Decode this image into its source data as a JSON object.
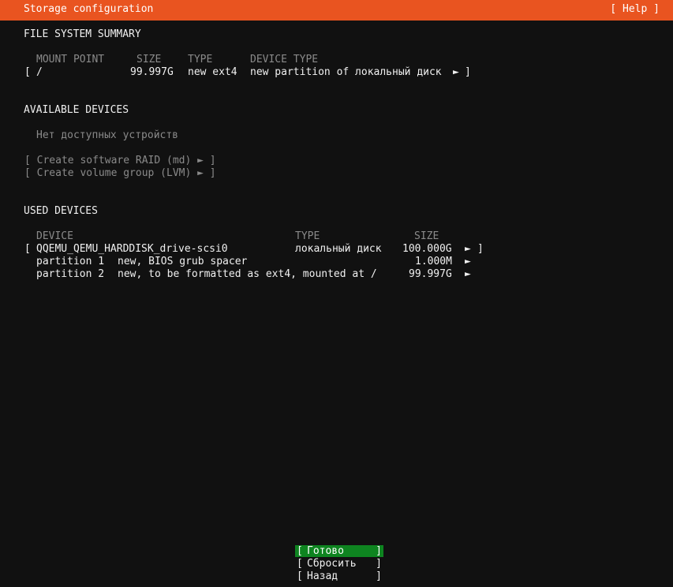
{
  "header": {
    "title": "Storage configuration",
    "help_label": "[ Help ]"
  },
  "fs_summary": {
    "heading": "FILE SYSTEM SUMMARY",
    "columns": {
      "mount_point": "MOUNT POINT",
      "size": "SIZE",
      "type": "TYPE",
      "device_type": "DEVICE TYPE"
    },
    "rows": [
      {
        "open_bracket": "[",
        "mount_point": "/",
        "size": "99.997G",
        "type": "new ext4",
        "device_type": "new partition of локальный диск",
        "arrow": "►",
        "close_bracket": "]"
      }
    ]
  },
  "available": {
    "heading": "AVAILABLE DEVICES",
    "empty_text": "Нет доступных устройств",
    "actions": [
      {
        "label": "[ Create software RAID (md) ► ]"
      },
      {
        "label": "[ Create volume group (LVM) ► ]"
      }
    ]
  },
  "used": {
    "heading": "USED DEVICES",
    "columns": {
      "device": "DEVICE",
      "type": "TYPE",
      "size": "SIZE"
    },
    "disk": {
      "open_bracket": "[",
      "device": "QQEMU_QEMU_HARDDISK_drive-scsi0",
      "type": "локальный диск",
      "size": "100.000G",
      "arrow": "►",
      "close_bracket": "]"
    },
    "partitions": [
      {
        "name": "partition 1",
        "desc": "new, BIOS grub spacer",
        "size": "1.000M",
        "arrow": "►"
      },
      {
        "name": "partition 2",
        "desc": "new, to be formatted as ext4, mounted at /",
        "size": "99.997G",
        "arrow": "►"
      }
    ]
  },
  "footer": {
    "buttons": [
      {
        "open": "[",
        "label": "Готово",
        "close": "]",
        "selected": true
      },
      {
        "open": "[",
        "label": "Сбросить",
        "close": "]",
        "selected": false
      },
      {
        "open": "[",
        "label": "Назад",
        "close": "]",
        "selected": false
      }
    ]
  },
  "colors": {
    "header_bg": "#e95420",
    "background": "#111111",
    "selected_button_bg": "#0e8420",
    "dim_text": "#8a8a8a"
  }
}
